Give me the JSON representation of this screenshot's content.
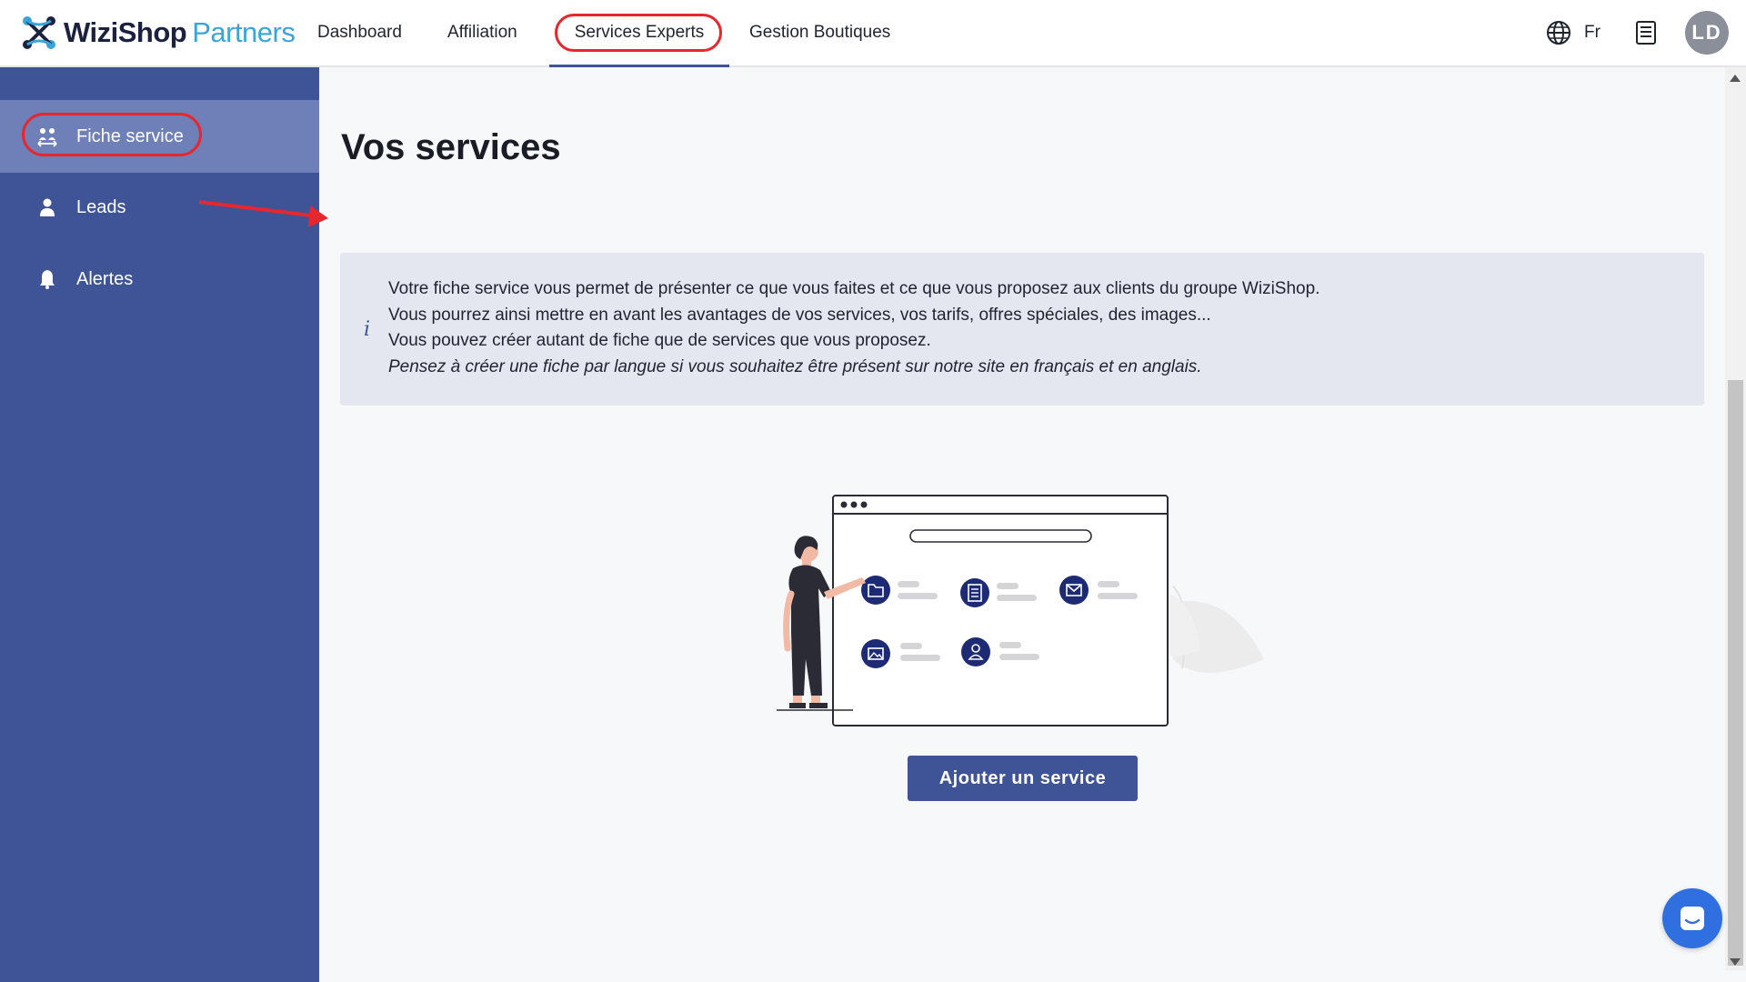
{
  "header": {
    "logo_brand": "WiziShop",
    "logo_suffix": "Partners",
    "nav": [
      {
        "label": "Dashboard"
      },
      {
        "label": "Affiliation"
      },
      {
        "label": "Services Experts"
      },
      {
        "label": "Gestion Boutiques"
      }
    ],
    "language": "Fr",
    "avatar_initials": "LD"
  },
  "sidebar": {
    "items": [
      {
        "label": "Fiche service",
        "icon": "people-arrows-icon"
      },
      {
        "label": "Leads",
        "icon": "user-icon"
      },
      {
        "label": "Alertes",
        "icon": "bell-icon"
      }
    ]
  },
  "main": {
    "title": "Vos services",
    "info": {
      "line1": "Votre fiche service vous permet de présenter ce que vous faites et ce que vous proposez aux clients du groupe WiziShop.",
      "line2": "Vous pourrez ainsi mettre en avant les avantages de vos services, vos tarifs, offres spéciales, des images...",
      "line3": "Vous pouvez créer autant de fiche que de services que vous proposez.",
      "line4": "Pensez à créer une fiche par langue si vous souhaitez être présent sur notre site en français et en anglais."
    },
    "add_button": "Ajouter un service"
  },
  "colors": {
    "sidebar": "#3e5497",
    "sidebar_active": "#6e80b7",
    "primary": "#3e5497",
    "annotation": "#e8262d",
    "info_bg": "#e4e7ef"
  }
}
